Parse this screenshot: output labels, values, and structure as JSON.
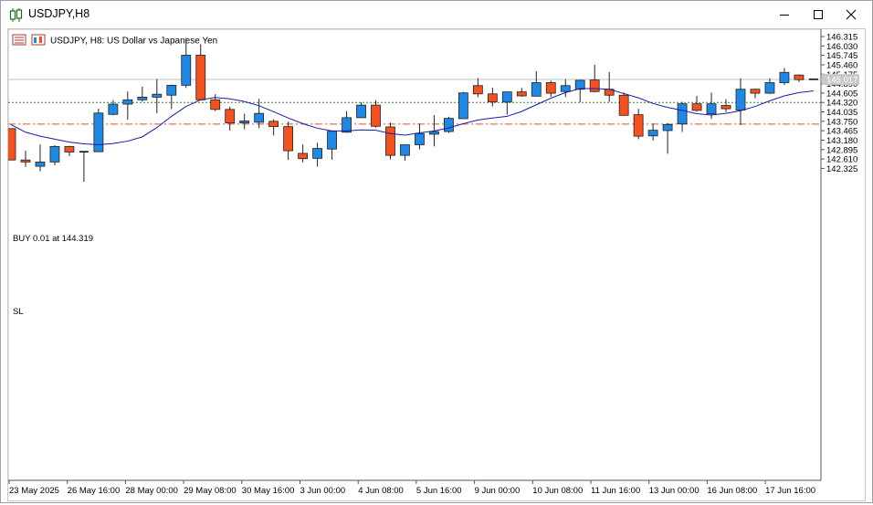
{
  "window": {
    "title": "USDJPY,H8"
  },
  "chart": {
    "caption": "USDJPY, H8:  US Dollar vs Japanese Yen",
    "buy_label": "BUY 0.01 at 144.319",
    "sl_label": "SL",
    "current_price_label": "145.017",
    "colors": {
      "bull": "#1e88e5",
      "bear": "#f4511e",
      "candle_outline": "#222222",
      "ma": "#1a1aa6",
      "buy_line": "#2e8b2e",
      "sl_line": "#e05030",
      "price_line": "#c0c0c0",
      "price_tag_bg": "#c8c8c8"
    },
    "price_ticks": [
      "146.315",
      "146.030",
      "145.745",
      "145.460",
      "145.175",
      "144.890",
      "144.605",
      "144.320",
      "144.035",
      "143.750",
      "143.465",
      "143.180",
      "142.895",
      "142.610",
      "142.325"
    ],
    "time_ticks": [
      "23 May 2025",
      "26 May 16:00",
      "28 May 00:00",
      "29 May 08:00",
      "30 May 16:00",
      "3 Jun 00:00",
      "4 Jun 08:00",
      "5 Jun 16:00",
      "9 Jun 00:00",
      "10 Jun 08:00",
      "11 Jun 16:00",
      "13 Jun 00:00",
      "16 Jun 08:00",
      "17 Jun 16:00"
    ]
  },
  "chart_data": {
    "type": "candlestick",
    "symbol": "USDJPY",
    "timeframe": "H8",
    "ylim": [
      142.1,
      146.37
    ],
    "current_price": 145.017,
    "buy_level": 144.319,
    "sl_level": 143.665,
    "candles": [
      {
        "o": 143.53,
        "h": 143.53,
        "l": 142.58,
        "c": 142.58
      },
      {
        "o": 142.58,
        "h": 142.86,
        "l": 142.37,
        "c": 142.52
      },
      {
        "o": 142.39,
        "h": 143.05,
        "l": 142.24,
        "c": 142.52
      },
      {
        "o": 142.52,
        "h": 143.03,
        "l": 142.42,
        "c": 142.99
      },
      {
        "o": 142.99,
        "h": 143.01,
        "l": 142.7,
        "c": 142.82
      },
      {
        "o": 142.82,
        "h": 142.85,
        "l": 141.92,
        "c": 142.83
      },
      {
        "o": 142.83,
        "h": 144.13,
        "l": 142.83,
        "c": 144.0
      },
      {
        "o": 143.96,
        "h": 144.39,
        "l": 143.93,
        "c": 144.27
      },
      {
        "o": 144.27,
        "h": 144.65,
        "l": 143.8,
        "c": 144.4
      },
      {
        "o": 144.4,
        "h": 144.8,
        "l": 144.35,
        "c": 144.48
      },
      {
        "o": 144.48,
        "h": 145.03,
        "l": 144.0,
        "c": 144.57
      },
      {
        "o": 144.54,
        "h": 144.86,
        "l": 144.12,
        "c": 144.84
      },
      {
        "o": 144.84,
        "h": 146.27,
        "l": 144.76,
        "c": 145.75
      },
      {
        "o": 145.75,
        "h": 146.08,
        "l": 144.4,
        "c": 144.4
      },
      {
        "o": 144.4,
        "h": 144.57,
        "l": 144.06,
        "c": 144.11
      },
      {
        "o": 144.11,
        "h": 144.19,
        "l": 143.47,
        "c": 143.7
      },
      {
        "o": 143.7,
        "h": 143.98,
        "l": 143.51,
        "c": 143.76
      },
      {
        "o": 143.72,
        "h": 144.43,
        "l": 143.54,
        "c": 143.99
      },
      {
        "o": 143.75,
        "h": 143.81,
        "l": 143.32,
        "c": 143.59
      },
      {
        "o": 143.59,
        "h": 143.74,
        "l": 142.58,
        "c": 142.86
      },
      {
        "o": 142.78,
        "h": 143.05,
        "l": 142.51,
        "c": 142.62
      },
      {
        "o": 142.63,
        "h": 143.1,
        "l": 142.38,
        "c": 142.93
      },
      {
        "o": 142.91,
        "h": 143.46,
        "l": 142.59,
        "c": 143.45
      },
      {
        "o": 143.42,
        "h": 144.06,
        "l": 143.4,
        "c": 143.86
      },
      {
        "o": 143.86,
        "h": 144.32,
        "l": 143.85,
        "c": 144.24
      },
      {
        "o": 144.24,
        "h": 144.39,
        "l": 143.56,
        "c": 143.6
      },
      {
        "o": 143.58,
        "h": 143.71,
        "l": 142.6,
        "c": 142.72
      },
      {
        "o": 142.72,
        "h": 143.05,
        "l": 142.56,
        "c": 143.04
      },
      {
        "o": 143.04,
        "h": 143.68,
        "l": 142.9,
        "c": 143.38
      },
      {
        "o": 143.36,
        "h": 143.94,
        "l": 142.99,
        "c": 143.44
      },
      {
        "o": 143.44,
        "h": 143.89,
        "l": 143.4,
        "c": 143.84
      },
      {
        "o": 143.83,
        "h": 144.64,
        "l": 143.83,
        "c": 144.61
      },
      {
        "o": 144.83,
        "h": 145.06,
        "l": 144.48,
        "c": 144.58
      },
      {
        "o": 144.58,
        "h": 144.77,
        "l": 144.2,
        "c": 144.34
      },
      {
        "o": 144.33,
        "h": 144.64,
        "l": 143.95,
        "c": 144.64
      },
      {
        "o": 144.64,
        "h": 144.76,
        "l": 144.49,
        "c": 144.52
      },
      {
        "o": 144.51,
        "h": 145.27,
        "l": 144.51,
        "c": 144.92
      },
      {
        "o": 144.92,
        "h": 144.98,
        "l": 144.49,
        "c": 144.6
      },
      {
        "o": 144.65,
        "h": 145.02,
        "l": 144.48,
        "c": 144.83
      },
      {
        "o": 144.72,
        "h": 145.01,
        "l": 144.33,
        "c": 144.99
      },
      {
        "o": 145.0,
        "h": 145.46,
        "l": 144.63,
        "c": 144.65
      },
      {
        "o": 144.72,
        "h": 145.24,
        "l": 144.34,
        "c": 144.54
      },
      {
        "o": 144.54,
        "h": 144.62,
        "l": 143.93,
        "c": 143.93
      },
      {
        "o": 143.95,
        "h": 144.13,
        "l": 143.21,
        "c": 143.3
      },
      {
        "o": 143.31,
        "h": 143.68,
        "l": 143.17,
        "c": 143.48
      },
      {
        "o": 143.47,
        "h": 143.7,
        "l": 142.77,
        "c": 143.65
      },
      {
        "o": 143.67,
        "h": 144.34,
        "l": 143.43,
        "c": 144.28
      },
      {
        "o": 144.28,
        "h": 144.52,
        "l": 144.04,
        "c": 144.08
      },
      {
        "o": 143.98,
        "h": 144.62,
        "l": 143.83,
        "c": 144.28
      },
      {
        "o": 144.23,
        "h": 144.42,
        "l": 144.03,
        "c": 144.13
      },
      {
        "o": 144.09,
        "h": 145.05,
        "l": 143.64,
        "c": 144.72
      },
      {
        "o": 144.72,
        "h": 144.74,
        "l": 144.45,
        "c": 144.6
      },
      {
        "o": 144.6,
        "h": 145.05,
        "l": 144.58,
        "c": 144.92
      },
      {
        "o": 144.92,
        "h": 145.36,
        "l": 144.85,
        "c": 145.23
      },
      {
        "o": 145.15,
        "h": 145.17,
        "l": 144.94,
        "c": 145.01
      },
      {
        "o": 145.02,
        "h": 145.02,
        "l": 145.01,
        "c": 145.01
      }
    ],
    "moving_average": [
      143.65,
      143.42,
      143.3,
      143.21,
      143.12,
      143.07,
      143.04,
      143.08,
      143.15,
      143.28,
      143.56,
      143.9,
      144.2,
      144.4,
      144.47,
      144.43,
      144.35,
      144.22,
      144.04,
      143.85,
      143.68,
      143.54,
      143.46,
      143.46,
      143.49,
      143.48,
      143.38,
      143.33,
      143.4,
      143.46,
      143.55,
      143.68,
      143.79,
      143.85,
      143.9,
      144.05,
      144.25,
      144.45,
      144.62,
      144.74,
      144.74,
      144.72,
      144.59,
      144.46,
      144.29,
      144.17,
      144.08,
      143.98,
      143.94,
      143.99,
      144.07,
      144.2,
      144.37,
      144.52,
      144.62,
      144.67
    ]
  }
}
